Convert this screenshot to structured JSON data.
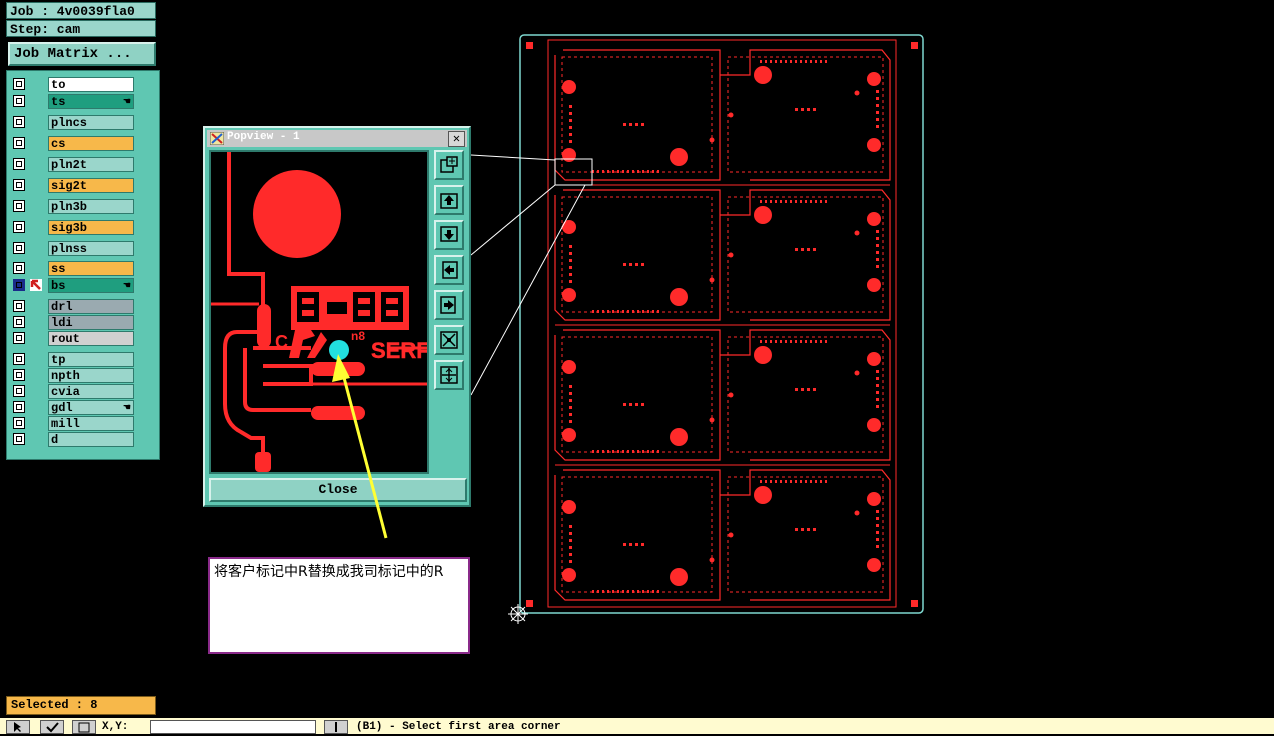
{
  "job": {
    "job_label": "Job : 4v0039fla0",
    "step_label": "Step: cam",
    "job_matrix_button": "Job Matrix ..."
  },
  "layers": {
    "group1": [
      {
        "name": "to",
        "color": "#ffffff",
        "selected": false
      },
      {
        "name": "ts",
        "color": "#1f9e7f",
        "selected": false,
        "flag": "hand"
      }
    ],
    "group2": [
      {
        "name": "plncs",
        "color": "#9ad6cb"
      },
      {
        "name": "cs",
        "color": "#f7b84a"
      },
      {
        "name": "pln2t",
        "color": "#9ad6cb"
      },
      {
        "name": "sig2t",
        "color": "#f7b84a"
      },
      {
        "name": "pln3b",
        "color": "#9ad6cb"
      },
      {
        "name": "sig3b",
        "color": "#f7b84a"
      },
      {
        "name": "plnss",
        "color": "#9ad6cb"
      }
    ],
    "group3": [
      {
        "name": "ss",
        "color": "#f7b84a"
      },
      {
        "name": "bs",
        "color": "#1f9e7f",
        "active": true,
        "flag": "hand"
      }
    ],
    "group4": [
      {
        "name": "drl",
        "color": "#9aaab0"
      },
      {
        "name": "ldi",
        "color": "#9aaab0"
      },
      {
        "name": "rout",
        "color": "#d0d0d0"
      }
    ],
    "group5": [
      {
        "name": "tp",
        "color": "#9ad6cb"
      },
      {
        "name": "npth",
        "color": "#9ad6cb"
      },
      {
        "name": "cvia",
        "color": "#9ad6cb"
      },
      {
        "name": "gdl",
        "color": "#9ad6cb",
        "flag": "hand"
      },
      {
        "name": "mill",
        "color": "#9ad6cb"
      },
      {
        "name": "d",
        "color": "#9ad6cb"
      }
    ]
  },
  "selected_label": "Selected : 8",
  "popview": {
    "title": "Popview - 1",
    "close_label": "Close",
    "tools": [
      "zoom-in-icon",
      "pan-up-icon",
      "pan-down-icon",
      "pan-left-icon",
      "pan-right-icon",
      "fit-icon",
      "zoom-out-icon"
    ]
  },
  "note": {
    "text": "将客户标记中R替换成我司标记中的R"
  },
  "bottom_bar": {
    "xy_label": "X,Y:",
    "status": "(B1) - Select first area corner"
  },
  "colors": {
    "panel": "#5fc7b2",
    "board_trace": "#ff2a2a",
    "board_outline": "#7fd8d0",
    "cursor": "#22e0e0",
    "arrow": "#ffff33"
  }
}
